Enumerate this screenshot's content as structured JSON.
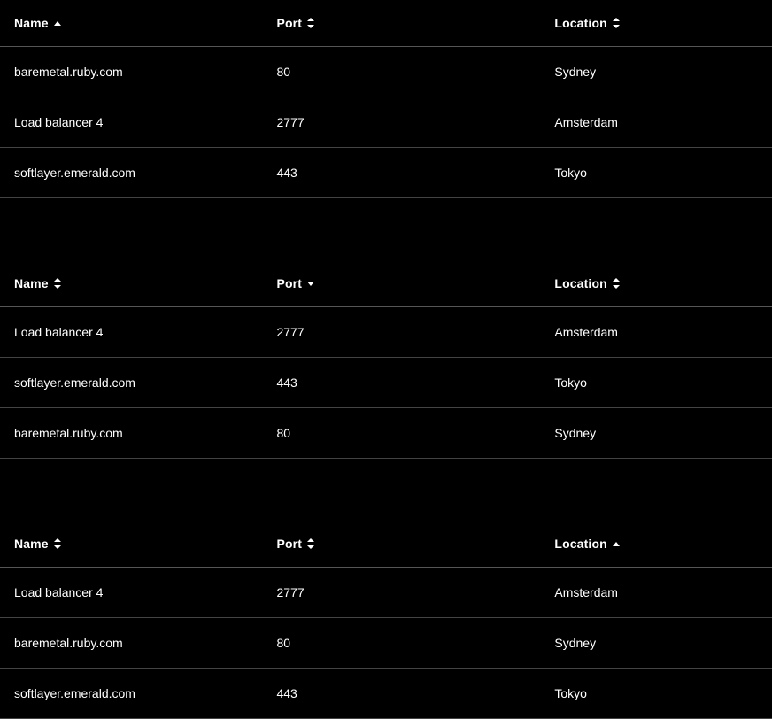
{
  "columns": {
    "name": "Name",
    "port": "Port",
    "location": "Location"
  },
  "tables": [
    {
      "sorted_column": "name",
      "sort_direction": "asc",
      "rows": [
        {
          "name": "baremetal.ruby.com",
          "port": "80",
          "location": "Sydney"
        },
        {
          "name": "Load balancer 4",
          "port": "2777",
          "location": "Amsterdam"
        },
        {
          "name": "softlayer.emerald.com",
          "port": "443",
          "location": "Tokyo"
        }
      ]
    },
    {
      "sorted_column": "port",
      "sort_direction": "desc",
      "rows": [
        {
          "name": "Load balancer 4",
          "port": "2777",
          "location": "Amsterdam"
        },
        {
          "name": "softlayer.emerald.com",
          "port": "443",
          "location": "Tokyo"
        },
        {
          "name": "baremetal.ruby.com",
          "port": "80",
          "location": "Sydney"
        }
      ]
    },
    {
      "sorted_column": "location",
      "sort_direction": "asc",
      "rows": [
        {
          "name": "Load balancer 4",
          "port": "2777",
          "location": "Amsterdam"
        },
        {
          "name": "baremetal.ruby.com",
          "port": "80",
          "location": "Sydney"
        },
        {
          "name": "softlayer.emerald.com",
          "port": "443",
          "location": "Tokyo"
        }
      ]
    }
  ]
}
